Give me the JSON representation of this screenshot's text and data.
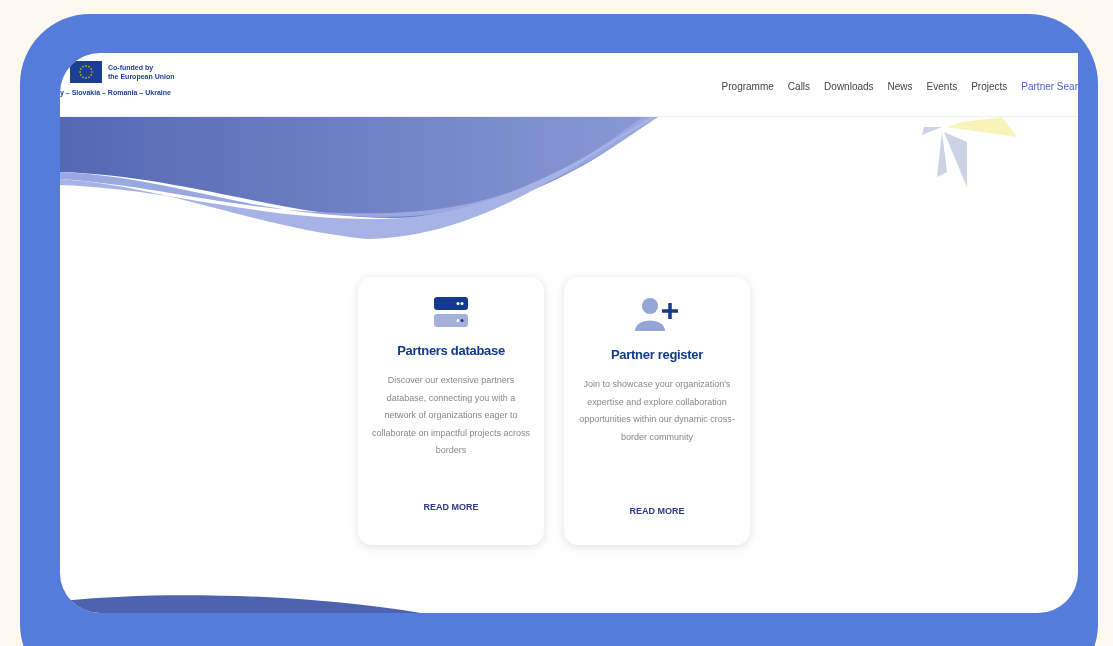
{
  "header": {
    "logo_text": [
      "Co-funded by",
      "the European Union"
    ],
    "tagline": "y – Slovakia – Romania – Ukraine"
  },
  "nav": [
    {
      "label": "Programme",
      "selected": false
    },
    {
      "label": "Calls",
      "selected": false
    },
    {
      "label": "Downloads",
      "selected": false
    },
    {
      "label": "News",
      "selected": false
    },
    {
      "label": "Events",
      "selected": false
    },
    {
      "label": "Projects",
      "selected": false
    },
    {
      "label": "Partner Sear",
      "selected": true
    }
  ],
  "cards": [
    {
      "kind": "database",
      "title": "Partners database",
      "text": "Discover our extensive partners database, connecting you with a network of organizations eager to collaborate on impactful projects across borders",
      "link": "READ MORE"
    },
    {
      "kind": "register",
      "title": "Partner register",
      "text": "Join to showcase your organization's expertise and explore collaboration opportunities within our dynamic cross-border community",
      "link": "READ MORE"
    }
  ]
}
